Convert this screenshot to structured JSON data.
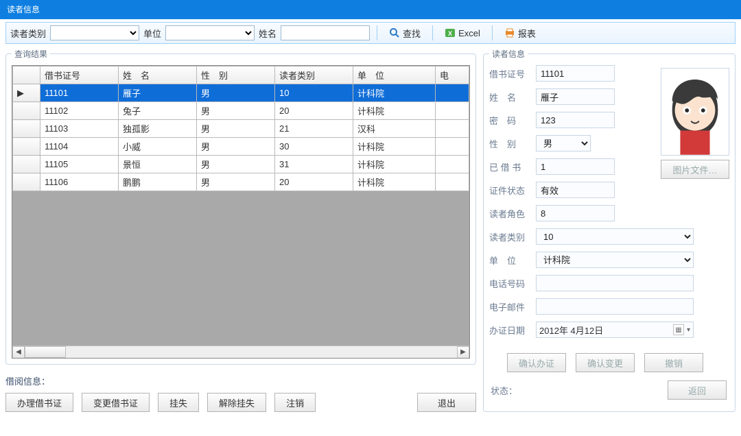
{
  "title": "读者信息",
  "toolbar": {
    "category_label": "读者类别",
    "unit_label": "单位",
    "name_label": "姓名",
    "search_label": "查找",
    "excel_label": "Excel",
    "report_label": "报表"
  },
  "results": {
    "legend": "查询结果",
    "columns": [
      "借书证号",
      "姓　名",
      "性　别",
      "读者类别",
      "单　位",
      "电"
    ],
    "selected_index": 0,
    "rows": [
      {
        "id": "11101",
        "name": "雁子",
        "gender": "男",
        "cat": "10",
        "unit": "计科院",
        "tel": ""
      },
      {
        "id": "11102",
        "name": "兔子",
        "gender": "男",
        "cat": "20",
        "unit": "计科院",
        "tel": ""
      },
      {
        "id": "11103",
        "name": "独孤影",
        "gender": "男",
        "cat": "21",
        "unit": "汉科",
        "tel": ""
      },
      {
        "id": "11104",
        "name": "小威",
        "gender": "男",
        "cat": "30",
        "unit": "计科院",
        "tel": ""
      },
      {
        "id": "11105",
        "name": "景恒",
        "gender": "男",
        "cat": "31",
        "unit": "计科院",
        "tel": ""
      },
      {
        "id": "11106",
        "name": "鹏鹏",
        "gender": "男",
        "cat": "20",
        "unit": "计科院",
        "tel": ""
      }
    ]
  },
  "borrow_info_label": "借阅信息：",
  "left_buttons": {
    "apply": "办理借书证",
    "change": "变更借书证",
    "lost": "挂失",
    "unlost": "解除挂失",
    "cancel": "注销",
    "exit": "退出"
  },
  "detail": {
    "legend": "读者信息",
    "labels": {
      "id": "借书证号",
      "name": "姓　名",
      "pwd": "密　码",
      "gender": "性　别",
      "borrowed": "已 借 书",
      "status": "证件状态",
      "role": "读者角色",
      "category": "读者类别",
      "unit": "单　位",
      "phone": "电话号码",
      "email": "电子邮件",
      "date": "办证日期"
    },
    "values": {
      "id": "11101",
      "name": "雁子",
      "pwd": "123",
      "gender": "男",
      "borrowed": "1",
      "status": "有效",
      "role": "8",
      "category": "10",
      "unit": "计科院",
      "phone": "",
      "email": "",
      "date": "2012年 4月12日"
    },
    "img_btn": "图片文件…",
    "confirm_apply": "确认办证",
    "confirm_change": "确认变更",
    "revoke": "撤销",
    "status_label": "状态：",
    "return": "返回"
  }
}
